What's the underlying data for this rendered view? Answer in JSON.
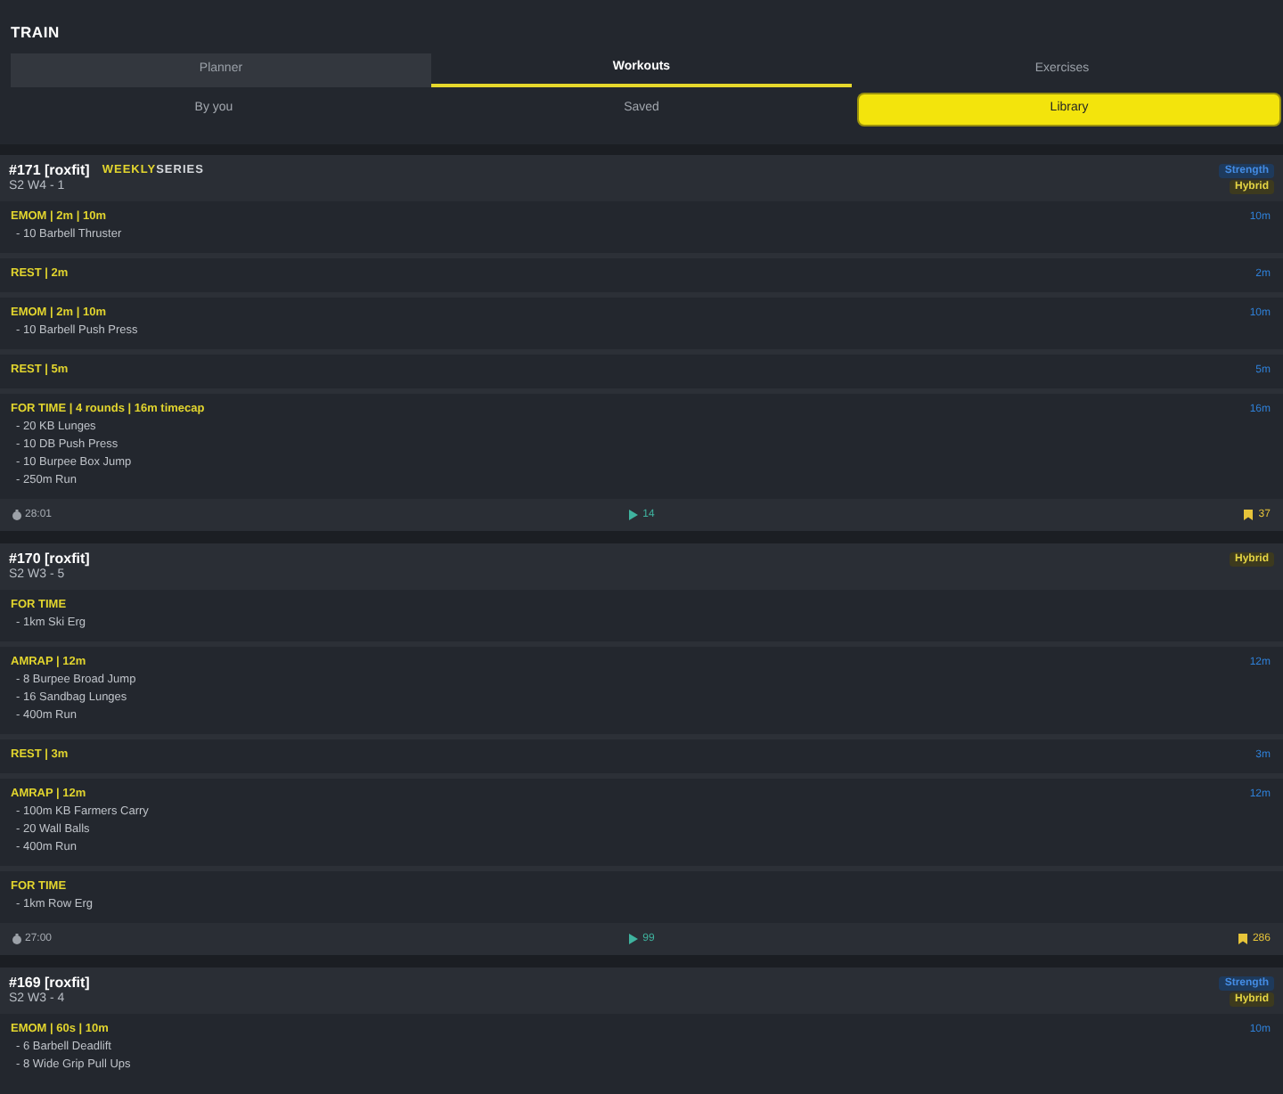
{
  "page": {
    "title": "TRAIN"
  },
  "tabs": [
    {
      "label": "Planner",
      "selected": false,
      "highlighted": true
    },
    {
      "label": "Workouts",
      "selected": true,
      "highlighted": false
    },
    {
      "label": "Exercises",
      "selected": false,
      "highlighted": false
    }
  ],
  "subtabs": [
    {
      "label": "By you",
      "selected": false
    },
    {
      "label": "Saved",
      "selected": false
    },
    {
      "label": "Library",
      "selected": true
    }
  ],
  "workouts": [
    {
      "title": "#171 [roxfit]",
      "series_label": {
        "highlight": "WEEKLY",
        "text": "SERIES"
      },
      "subtitle": "S2 W4 - 1",
      "tags": [
        {
          "label": "Strength",
          "color": "#1e3a5c"
        },
        {
          "label": "Hybrid",
          "color": "#3d3a1e"
        }
      ],
      "sections": [
        {
          "header": "EMOM | 2m | 10m",
          "duration": "10m",
          "items": [
            "- 10 Barbell Thruster"
          ]
        },
        {
          "header": "REST | 2m",
          "duration": "2m"
        },
        {
          "header": "EMOM | 2m | 10m",
          "duration": "10m",
          "items": [
            "- 10 Barbell Push Press"
          ]
        },
        {
          "header": "REST | 5m",
          "duration": "5m"
        },
        {
          "header": "FOR TIME | 4 rounds | 16m timecap",
          "duration": "16m",
          "items": [
            "- 20 KB Lunges",
            "- 10 DB Push Press",
            "- 10 Burpee Box Jump",
            "- 250m Run"
          ]
        }
      ],
      "footer": {
        "duration": "28:01",
        "plays": "14",
        "bookmarks": "37"
      }
    },
    {
      "title": "#170 [roxfit]",
      "subtitle": "S2 W3 - 5",
      "tags": [
        {
          "label": "Hybrid",
          "color": "#3d3a1e"
        }
      ],
      "sections": [
        {
          "header": "FOR TIME",
          "items": [
            "- 1km Ski Erg"
          ]
        },
        {
          "header": "AMRAP | 12m",
          "duration": "12m",
          "items": [
            "- 8 Burpee Broad Jump",
            "- 16 Sandbag Lunges",
            "- 400m Run"
          ]
        },
        {
          "header": "REST | 3m",
          "duration": "3m"
        },
        {
          "header": "AMRAP | 12m",
          "duration": "12m",
          "items": [
            "- 100m KB Farmers Carry",
            "- 20 Wall Balls",
            "- 400m Run"
          ]
        },
        {
          "header": "FOR TIME",
          "items": [
            "- 1km Row Erg"
          ]
        }
      ],
      "footer": {
        "duration": "27:00",
        "plays": "99",
        "bookmarks": "286"
      }
    },
    {
      "title": "#169 [roxfit]",
      "subtitle": "S2 W3 - 4",
      "tags": [
        {
          "label": "Strength",
          "color": "#1e3a5c"
        },
        {
          "label": "Hybrid",
          "color": "#3d3a1e"
        }
      ],
      "sections": [
        {
          "header": "EMOM | 60s | 10m",
          "duration": "10m",
          "items": [
            "- 6 Barbell Deadlift",
            "- 8 Wide Grip Pull Ups"
          ]
        }
      ]
    }
  ]
}
